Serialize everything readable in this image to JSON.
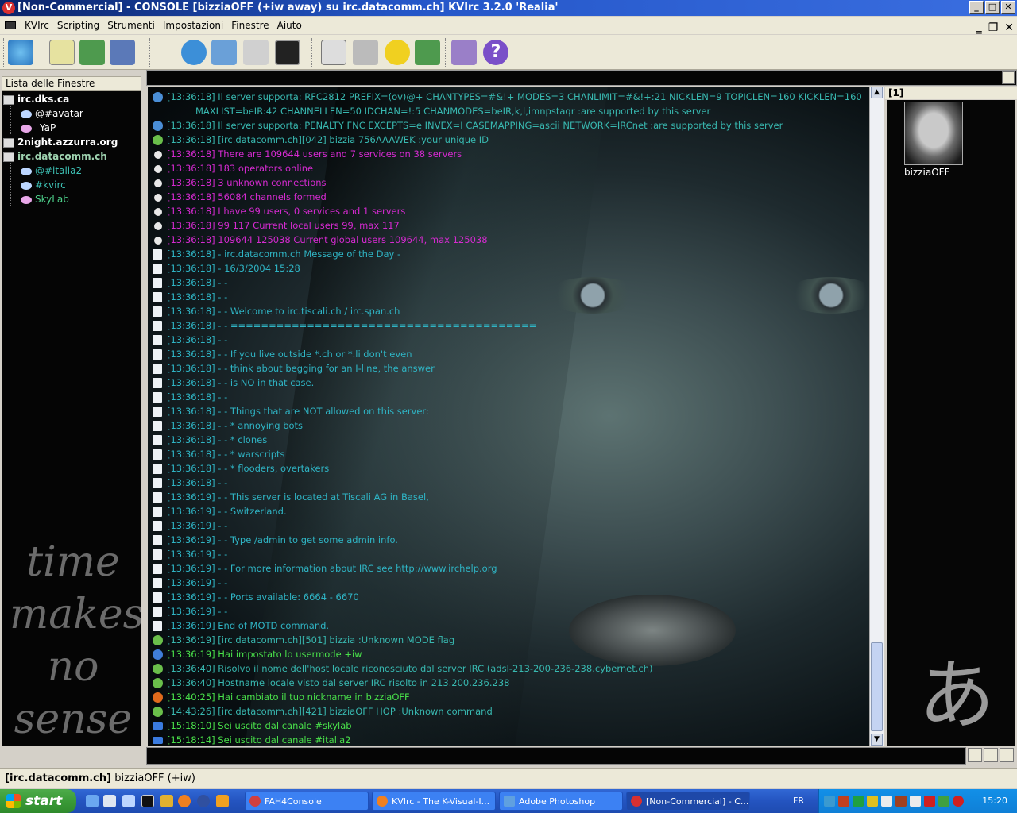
{
  "window": {
    "title": "[Non-Commercial] - CONSOLE [bizziaOFF (+iw away) su irc.datacomm.ch] KVIrc 3.2.0 'Realia'",
    "app_icon": "V"
  },
  "menubar": {
    "items": [
      "KVIrc",
      "Scripting",
      "Strumenti",
      "Impostazioni",
      "Finestre",
      "Aiuto"
    ]
  },
  "winlist": {
    "header": "Lista delle Finestre",
    "servers": [
      {
        "name": "irc.dks.ca",
        "children": [
          "@#avatar",
          "_YaP"
        ]
      },
      {
        "name": "2night.azzurra.org",
        "children": []
      },
      {
        "name": "irc.datacomm.ch",
        "children": [
          "@#italia2",
          "#kvirc",
          "SkyLab"
        ]
      }
    ],
    "background_text": [
      "time",
      "makes",
      "no",
      "sense"
    ]
  },
  "console": {
    "lines": [
      {
        "type": "info",
        "color": "teal",
        "text": "[13:36:18] Il server supporta: RFC2812 PREFIX=(ov)@+ CHANTYPES=#&!+ MODES=3 CHANLIMIT=#&!+:21 NICKLEN=9 TOPICLEN=160 KICKLEN=160"
      },
      {
        "type": "wrap",
        "color": "teal",
        "text": "MAXLIST=beIR:42 CHANNELLEN=50 IDCHAN=!:5 CHANMODES=beIR,k,l,imnpstaqr :are supported by this server"
      },
      {
        "type": "info",
        "color": "teal",
        "text": "[13:36:18] Il server supporta: PENALTY FNC EXCEPTS=e INVEX=I CASEMAPPING=ascii NETWORK=IRCnet :are supported by this server"
      },
      {
        "type": "ok",
        "color": "teal",
        "text": "[13:36:18] [irc.datacomm.ch][042] bizzia 756AAAWEK :your unique ID"
      },
      {
        "type": "dot",
        "color": "magenta",
        "text": "[13:36:18] There are 109644 users and 7 services on 38 servers"
      },
      {
        "type": "dot",
        "color": "magenta",
        "text": "[13:36:18] 183 operators online"
      },
      {
        "type": "dot",
        "color": "magenta",
        "text": "[13:36:18] 3 unknown connections"
      },
      {
        "type": "dot",
        "color": "magenta",
        "text": "[13:36:18] 56084 channels formed"
      },
      {
        "type": "dot",
        "color": "magenta",
        "text": "[13:36:18] I have 99 users, 0 services and 1 servers"
      },
      {
        "type": "dot",
        "color": "magenta",
        "text": "[13:36:18] 99 117 Current local users 99, max 117"
      },
      {
        "type": "dot",
        "color": "magenta",
        "text": "[13:36:18] 109644 125038 Current global users 109644, max 125038"
      },
      {
        "type": "doc",
        "color": "cyan",
        "text": "[13:36:18] - irc.datacomm.ch Message of the Day -"
      },
      {
        "type": "doc",
        "color": "cyan",
        "text": "[13:36:18] - 16/3/2004 15:28"
      },
      {
        "type": "doc",
        "color": "cyan",
        "text": "[13:36:18] - -"
      },
      {
        "type": "doc",
        "color": "cyan",
        "text": "[13:36:18] - -"
      },
      {
        "type": "doc",
        "color": "cyan",
        "text": "[13:36:18] - - Welcome to irc.tiscali.ch / irc.span.ch"
      },
      {
        "type": "doc",
        "color": "cyan",
        "text": "[13:36:18] - - ========================================"
      },
      {
        "type": "doc",
        "color": "cyan",
        "text": "[13:36:18] - -"
      },
      {
        "type": "doc",
        "color": "cyan",
        "text": "[13:36:18] - - If you live outside *.ch or *.li don't even"
      },
      {
        "type": "doc",
        "color": "cyan",
        "text": "[13:36:18] - - think about begging for an I-line, the answer"
      },
      {
        "type": "doc",
        "color": "cyan",
        "text": "[13:36:18] - - is NO in that case."
      },
      {
        "type": "doc",
        "color": "cyan",
        "text": "[13:36:18] - -"
      },
      {
        "type": "doc",
        "color": "cyan",
        "text": "[13:36:18] - - Things that are NOT allowed on this server:"
      },
      {
        "type": "doc",
        "color": "cyan",
        "text": "[13:36:18] - - * annoying bots"
      },
      {
        "type": "doc",
        "color": "cyan",
        "text": "[13:36:18] - - * clones"
      },
      {
        "type": "doc",
        "color": "cyan",
        "text": "[13:36:18] - - * warscripts"
      },
      {
        "type": "doc",
        "color": "cyan",
        "text": "[13:36:18] - - * flooders, overtakers"
      },
      {
        "type": "doc",
        "color": "cyan",
        "text": "[13:36:18] - -"
      },
      {
        "type": "doc",
        "color": "cyan",
        "text": "[13:36:19] - - This server is located at Tiscali AG in Basel,"
      },
      {
        "type": "doc",
        "color": "cyan",
        "text": "[13:36:19] - - Switzerland."
      },
      {
        "type": "doc",
        "color": "cyan",
        "text": "[13:36:19] - -"
      },
      {
        "type": "doc",
        "color": "cyan",
        "text": "[13:36:19] - - Type /admin to get some admin info."
      },
      {
        "type": "doc",
        "color": "cyan",
        "text": "[13:36:19] - -"
      },
      {
        "type": "doc",
        "color": "cyan",
        "text": "[13:36:19] - - For more information about IRC see http://www.irchelp.org"
      },
      {
        "type": "doc",
        "color": "cyan",
        "text": "[13:36:19] - -"
      },
      {
        "type": "doc",
        "color": "cyan",
        "text": "[13:36:19] - - Ports available: 6664 - 6670"
      },
      {
        "type": "doc",
        "color": "cyan",
        "text": "[13:36:19] - -"
      },
      {
        "type": "doc",
        "color": "cyan",
        "text": "[13:36:19] End of MOTD command."
      },
      {
        "type": "ok",
        "color": "teal",
        "text": "[13:36:19] [irc.datacomm.ch][501] bizzia :Unknown MODE flag"
      },
      {
        "type": "user",
        "color": "green",
        "text": "[13:36:19] Hai impostato lo usermode +iw"
      },
      {
        "type": "ok",
        "color": "teal",
        "text": "[13:36:40] Risolvo il nome dell'host locale riconosciuto dal server IRC (adsl-213-200-236-238.cybernet.ch)"
      },
      {
        "type": "ok",
        "color": "teal",
        "text": "[13:36:40] Hostname locale visto dal server IRC risolto in 213.200.236.238"
      },
      {
        "type": "nick",
        "color": "green",
        "text": "[13:40:25] Hai cambiato il tuo nickname in bizziaOFF"
      },
      {
        "type": "ok",
        "color": "teal",
        "text": "[14:43:26] [irc.datacomm.ch][421] bizziaOFF HOP :Unknown command"
      },
      {
        "type": "part",
        "color": "green",
        "text": "[15:18:10] Sei uscito dal canale #skylab"
      },
      {
        "type": "part",
        "color": "green",
        "text": "[15:18:14] Sei uscito dal canale #italia2"
      }
    ],
    "watermark_glyph": "あ"
  },
  "userlist": {
    "header": "[1]",
    "users": [
      {
        "nick": "bizziaOFF"
      }
    ]
  },
  "input": {
    "value": ""
  },
  "statusbar": {
    "server": "[irc.datacomm.ch]",
    "nick_mode": "bizziaOFF (+iw)"
  },
  "taskbar": {
    "start_label": "start",
    "tasks": [
      {
        "label": "FAH4Console",
        "active": false
      },
      {
        "label": "KVIrc - The K-Visual-I...",
        "active": false
      },
      {
        "label": "Adobe Photoshop",
        "active": false
      },
      {
        "label": "[Non-Commercial] - C...",
        "active": true
      }
    ],
    "language": "FR",
    "clock": "15:20"
  },
  "colors": {
    "teal": "#38b8b0",
    "cyan": "#2fb4c4",
    "magenta": "#d52ad0",
    "green": "#49e04a"
  }
}
